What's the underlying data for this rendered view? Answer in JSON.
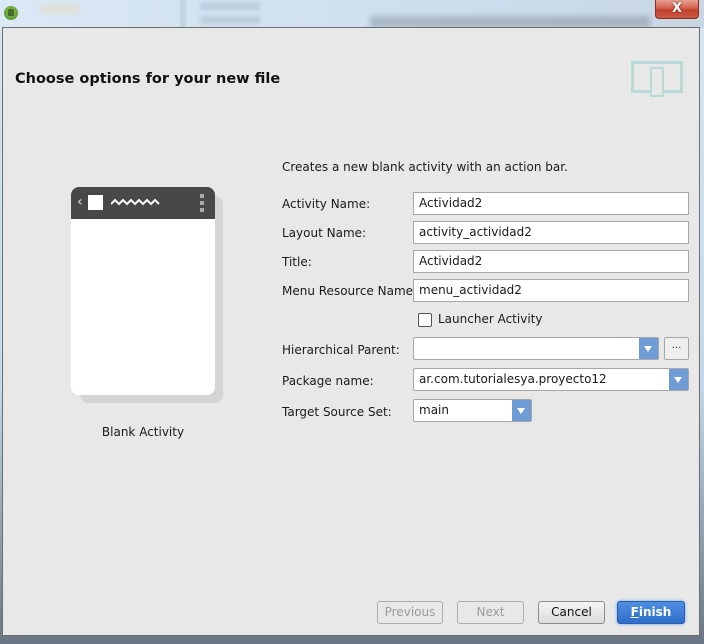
{
  "window": {
    "close_label": "X",
    "app_icon": "android-studio-icon"
  },
  "header": {
    "title": "Choose options for your new file",
    "icon": "device-tablet-phone-icon"
  },
  "preview": {
    "template_label": "Blank Activity",
    "actionbar_icons": [
      "back-chevron-icon",
      "app-icon",
      "title-squiggle",
      "overflow-menu-icon"
    ]
  },
  "form": {
    "description": "Creates a new blank activity with an action bar.",
    "fields": [
      {
        "label": "Activity Name:",
        "value": "Actividad2"
      },
      {
        "label": "Layout Name:",
        "value": "activity_actividad2"
      },
      {
        "label": "Title:",
        "value": "Actividad2"
      },
      {
        "label": "Menu Resource Name:",
        "value": "menu_actividad2"
      }
    ],
    "launcher_activity": {
      "label": "Launcher Activity",
      "checked": false
    },
    "hierarchical_parent": {
      "label": "Hierarchical Parent:",
      "value": "",
      "browse_label": "..."
    },
    "package_name": {
      "label": "Package name:",
      "value": "ar.com.tutorialesya.proyecto12"
    },
    "target_source_set": {
      "label": "Target Source Set:",
      "value": "main"
    }
  },
  "footer": {
    "previous_label": "Previous",
    "next_label": "Next",
    "cancel_label": "Cancel",
    "finish_label": "Finish",
    "finish_mnemonic": "F",
    "finish_rest": "inish"
  },
  "colors": {
    "accent": "#3a7bd5",
    "combo_arrow": "#6f9bd6",
    "dialog_bg": "#e8e8e8",
    "close_button": "#c9412c"
  }
}
